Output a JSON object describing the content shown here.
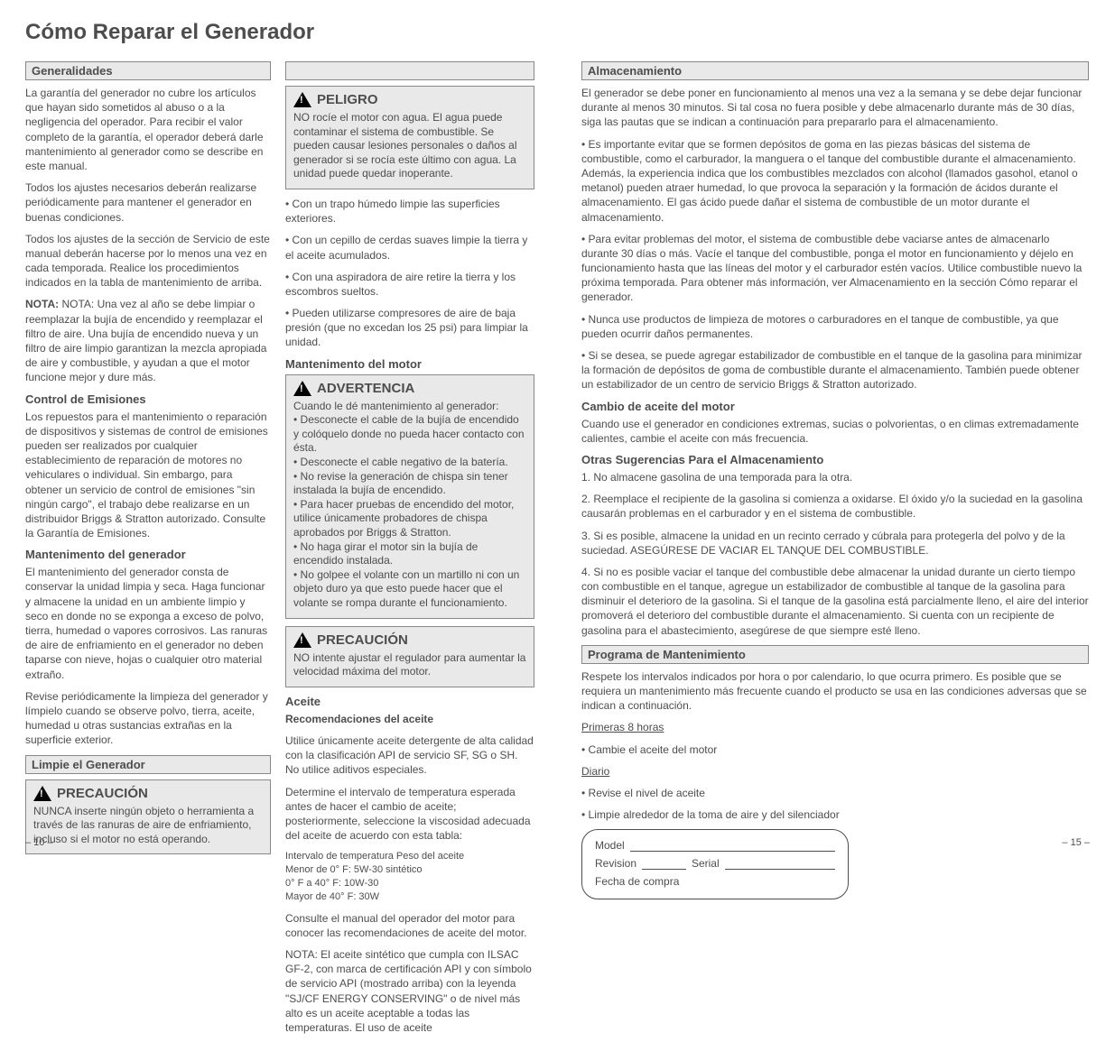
{
  "title": "Cómo Reparar el Generador",
  "col1": {
    "header": "Generalidades",
    "p1": "La garantía del generador no cubre los artículos que hayan sido sometidos al abuso o a la negligencia del operador. Para recibir el valor completo de la garantía, el operador deberá darle mantenimiento al generador como se describe en este manual.",
    "p2": "Todos los ajustes necesarios deberán realizarse periódicamente para mantener el generador en buenas condiciones.",
    "p3": "Todos los ajustes de la sección de Servicio de este manual deberán hacerse por lo menos una vez en cada temporada. Realice los procedimientos indicados en la tabla de mantenimiento de arriba.",
    "p4": "NOTA: Una vez al año se debe limpiar o reemplazar la bujía de encendido y reemplazar el filtro de aire. Una bujía de encendido nueva y un filtro de aire limpio garantizan la mezcla apropiada de aire y combustible, y ayudan a que el motor funcione mejor y dure más.",
    "sub1": "Control de Emisiones",
    "p5": "Los repuestos para el mantenimiento o reparación de dispositivos y sistemas de control de emisiones pueden ser realizados por cualquier establecimiento de reparación de motores no vehiculares o individual. Sin embargo, para obtener un servicio de control de emisiones \"sin ningún cargo\", el trabajo debe realizarse en un distribuidor Briggs & Stratton autorizado. Consulte la Garantía de Emisiones.",
    "sub2": "Mantenimento del generador",
    "p6": "El mantenimiento del generador consta de conservar la unidad limpia y seca. Haga funcionar y almacene la unidad en un ambiente limpio y seco en donde no se exponga a exceso de polvo, tierra, humedad o vapores corrosivos. Las ranuras de aire de enfriamiento en el generador no deben taparse con nieve, hojas o cualquier otro material extraño.",
    "p7": "Revise periódicamente la limpieza del generador y límpielo cuando se observe polvo, tierra, aceite, humedad u otras sustancias extrañas en la superficie exterior.",
    "alertHeader": "Limpie el Generador",
    "alertWord": "PRECAUCIÓN",
    "alertText": "NUNCA inserte ningún objeto o herramienta a través de las ranuras de aire de enfriamiento, incluso si el motor no está operando."
  },
  "col2": {
    "alert1Word": "PELIGRO",
    "alert1Text": "NO rocíe el motor con agua. El agua puede contaminar el sistema de combustible. Se pueden causar lesiones personales o daños al generador si se rocía este último con agua. La unidad puede quedar inoperante.",
    "bul1": "• Con un trapo húmedo limpie las superficies exteriores.",
    "bul2": "• Con un cepillo de cerdas suaves limpie la tierra y el aceite acumulados.",
    "bul3": "• Con una aspiradora de aire retire la tierra y los escombros sueltos.",
    "bul4": "• Pueden utilizarse compresores de aire de baja presión (que no excedan los 25 psi) para limpiar la unidad.",
    "sub1": "Mantenimento del motor",
    "alert2Word": "ADVERTENCIA",
    "alert2Text1": "Cuando le dé mantenimiento al generador:",
    "alert2b1": "• Desconecte el cable de la bujía de encendido y colóquelo donde no pueda hacer contacto con ésta.",
    "alert2b2": "• Desconecte el cable negativo de la batería.",
    "alert2b3": "• No revise la generación de chispa sin tener instalada la bujía de encendido.",
    "alert2b4": "• Para hacer pruebas de encendido del motor, utilice únicamente probadores de chispa aprobados por Briggs & Stratton.",
    "alert2b5": "• No haga girar el motor sin la bujía de encendido instalada.",
    "alert2b6": "• No golpee el volante con un martillo ni con un objeto duro ya que esto puede hacer que el volante se rompa durante el funcionamiento.",
    "alert3Word": "PRECAUCIÓN",
    "alert3Text": "NO intente ajustar el regulador para aumentar la velocidad máxima del motor.",
    "sub2": "Aceite",
    "oilHead": "Recomendaciones del aceite",
    "p1": "Utilice únicamente aceite detergente de alta calidad con la clasificación API de servicio SF, SG o SH. No utilice aditivos especiales.",
    "p2": "Determine el intervalo de temperatura esperada antes de hacer el cambio de aceite; posteriormente, seleccione la viscosidad adecuada del aceite de acuerdo con esta tabla:",
    "tableRows": [
      "Intervalo de temperatura  Peso del aceite",
      "Menor de 0° F: 5W-30 sintético",
      "0° F a 40° F: 10W-30",
      "Mayor de 40° F: 30W"
    ],
    "p3": "Consulte el manual del operador del motor para conocer las recomendaciones de aceite del motor.",
    "note": "NOTA: El aceite sintético que cumpla con ILSAC GF-2, con marca de certificación API y con símbolo de servicio API (mostrado arriba) con la leyenda \"SJ/CF ENERGY CONSERVING\" o de nivel más alto es un aceite aceptable a todas las temperaturas. El uso de aceite"
  },
  "col3": {
    "header1": "Almacenamiento",
    "p1": "El generador se debe poner en funcionamiento al menos una vez a la semana y se debe dejar funcionar durante al menos 30 minutos. Si tal cosa no fuera posible y debe almacenarlo durante más de 30 días, siga las pautas que se indican a continuación para prepararlo para el almacenamiento.",
    "p2": "• Es importante evitar que se formen depósitos de goma en las piezas básicas del sistema de combustible, como el carburador, la manguera o el tanque del combustible durante el almacenamiento. Además, la experiencia indica que los combustibles mezclados con alcohol (llamados gasohol, etanol o metanol) pueden atraer humedad, lo que provoca la separación y la formación de ácidos durante el almacenamiento. El gas ácido puede dañar el sistema de combustible de un motor durante el almacenamiento.",
    "p3": "• Para evitar problemas del motor, el sistema de combustible debe vaciarse antes de almacenarlo durante 30 días o más. Vacíe el tanque del combustible, ponga el motor en funcionamiento y déjelo en funcionamiento hasta que las líneas del motor y el carburador estén vacíos. Utilice combustible nuevo la próxima temporada. Para obtener más información, ver Almacenamiento en la sección Cómo reparar el generador.",
    "p4": "• Nunca use productos de limpieza de motores o carburadores en el tanque de combustible, ya que pueden ocurrir daños permanentes.",
    "p5": "• Si se desea, se puede agregar estabilizador de combustible en el tanque de la gasolina para minimizar la formación de depósitos de goma de combustible durante el almacenamiento. También puede obtener un estabilizador de un centro de servicio Briggs & Stratton autorizado.",
    "sub1": "Cambio de aceite del motor",
    "p6": "Cuando use el generador en condiciones extremas, sucias o polvorientas, o en climas extremadamente calientes, cambie el aceite con más frecuencia.",
    "sub2": "Otras Sugerencias Para el Almacenamiento",
    "h1": "1. No almacene gasolina de una temporada para la otra.",
    "h2": "2. Reemplace el recipiente de la gasolina si comienza a oxidarse. El óxido y/o la suciedad en la gasolina causarán problemas en el carburador y en el sistema de combustible.",
    "h3": "3. Si es posible, almacene la unidad en un recinto cerrado y cúbrala para protegerla del polvo y de la suciedad. ASEGÚRESE DE VACIAR EL TANQUE DEL COMBUSTIBLE.",
    "h4": "4. Si no es posible vaciar el tanque del combustible debe almacenar la unidad durante un cierto tiempo con combustible en el tanque, agregue un estabilizador de combustible al tanque de la gasolina para disminuir el deterioro de la gasolina. Si el tanque de la gasolina está parcialmente lleno, el aire del interior promoverá el deterioro del combustible durante el almacenamiento. Si cuenta con un recipiente de gasolina para el abastecimiento, asegúrese de que siempre esté lleno.",
    "header2": "Programa de Mantenimiento",
    "p7": "Respete los intervalos indicados por hora o por calendario, lo que ocurra primero. Es posible que se requiera un mantenimiento más frecuente cuando el producto se usa en las condiciones adversas que se indican a continuación.",
    "underline1": "Primeras 8 horas",
    "u1a": "• Cambie el aceite del motor",
    "underline2": "Diario",
    "u2a": "• Revise el nivel de aceite",
    "u2b": "• Limpie alrededor de la toma de aire y del silenciador",
    "recordLine1": "Model",
    "recordLine2": "Revision",
    "recordLine2b": "Serial",
    "recordDate": "Fecha de compra"
  },
  "footer": {
    "left": "– 10 –",
    "right": "– 15 –"
  }
}
